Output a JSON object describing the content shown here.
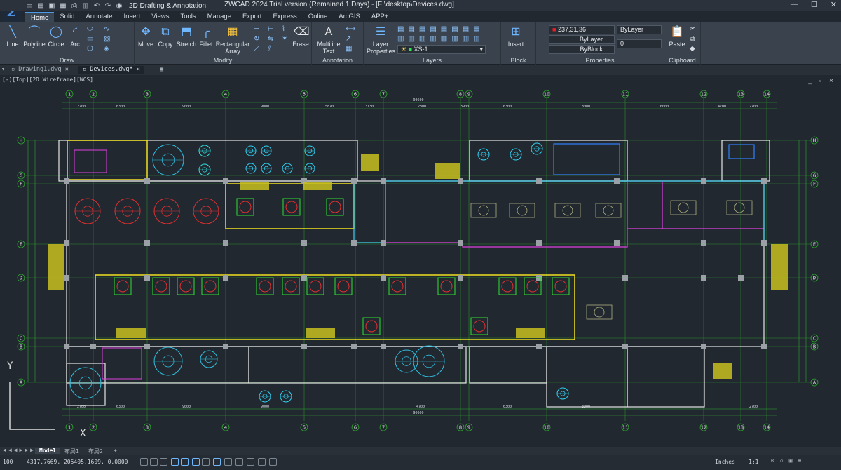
{
  "titlebar": {
    "workspace": "2D Drafting & Annotation",
    "title": "ZWCAD 2024 Trial version (Remained 1 Days) - [F:\\desktop\\Devices.dwg]"
  },
  "tabs": [
    "Home",
    "Solid",
    "Annotate",
    "Insert",
    "Views",
    "Tools",
    "Manage",
    "Export",
    "Express",
    "Online",
    "ArcGIS",
    "APP+"
  ],
  "ribbon": {
    "draw": {
      "label": "Draw",
      "buttons": [
        "Line",
        "Polyline",
        "Circle",
        "Arc"
      ]
    },
    "modify": {
      "label": "Modify",
      "buttons": [
        "Move",
        "Copy",
        "Stretch",
        "Fillet",
        "Rectangular Array",
        "Erase"
      ]
    },
    "annotation": {
      "label": "Annotation",
      "buttons": [
        "Multiline Text"
      ]
    },
    "layers": {
      "label": "Layers",
      "buttons": [
        "Layer Properties"
      ],
      "current_layer": "XS-1"
    },
    "block": {
      "label": "Block",
      "buttons": [
        "Insert"
      ]
    },
    "properties": {
      "label": "Properties",
      "color": "237,31,36",
      "linetype": "ByLayer",
      "lineweight": "ByBlock",
      "layer_prop": "ByLayer",
      "transparency": "0"
    },
    "clipboard": {
      "label": "Clipboard",
      "buttons": [
        "Paste"
      ]
    }
  },
  "doc_tabs": [
    "Drawing1.dwg",
    "Devices.dwg*"
  ],
  "viewport_label": "[-][Top][2D Wireframe][WCS]",
  "grid": {
    "columns": [
      "1",
      "2",
      "3",
      "4",
      "5",
      "6",
      "7",
      "8",
      "9",
      "10",
      "11",
      "12",
      "13",
      "14"
    ],
    "rows": [
      "H",
      "G",
      "F",
      "E",
      "D",
      "C",
      "B",
      "A"
    ],
    "top_dims": [
      "2700",
      "6300",
      "9000",
      "9000",
      "5870",
      "3130",
      "2800",
      "3900",
      "6300",
      "8000",
      "6000",
      "4700",
      "2700"
    ],
    "top_total": "90600",
    "bottom_dims": [
      "2700",
      "6300",
      "9000",
      "9000",
      "4700",
      "6300",
      "8000",
      "2700"
    ],
    "bottom_total": "90600",
    "bottom_mid": "90600"
  },
  "layout_tabs": [
    "Model",
    "布局1",
    "布局2",
    "+"
  ],
  "status": {
    "scale": "100",
    "coords": "4317.7669, 205405.1609, 0.0000",
    "units": "Inches",
    "annoscale": "1:1"
  }
}
